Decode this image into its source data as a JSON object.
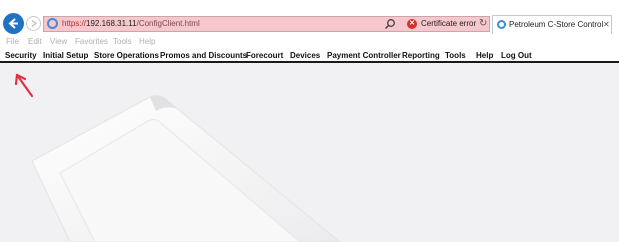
{
  "browser": {
    "url_protocol": "https://",
    "url_host": "192.168.31.11",
    "url_path": "/ConfigClient.html",
    "cert_error": "Certificate error",
    "tab_title": "Petroleum C-Store Control ...",
    "address_bg": "#f6c7cc",
    "back_color": "#1f73c4"
  },
  "ie_menu": [
    "File",
    "Edit",
    "View",
    "Favorites",
    "Tools",
    "Help"
  ],
  "nav": [
    "Security",
    "Initial Setup",
    "Store Operations",
    "Promos and Discounts",
    "Forecourt",
    "Devices",
    "Payment Controller",
    "Reporting",
    "Tools",
    "Help",
    "Log Out"
  ],
  "annotation": {
    "color": "#e03242"
  }
}
